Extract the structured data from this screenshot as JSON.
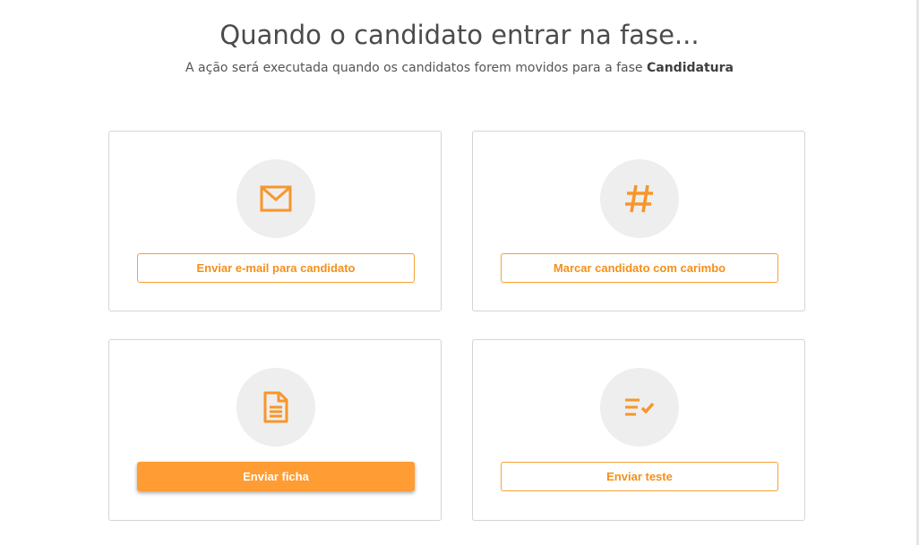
{
  "header": {
    "title": "Quando o candidato entrar na fase...",
    "subtitle_prefix": "A ação será executada quando os candidatos forem movidos para a fase ",
    "phase_name": "Candidatura"
  },
  "colors": {
    "accent": "#ff9c33",
    "accent_text": "#f58f1a",
    "icon_bg": "#eeeeee",
    "card_border": "#d4d4d4"
  },
  "actions": [
    {
      "icon": "envelope-icon",
      "label": "Enviar e-mail para candidato",
      "selected": false
    },
    {
      "icon": "hash-icon",
      "label": "Marcar candidato com carimbo",
      "selected": false
    },
    {
      "icon": "document-icon",
      "label": "Enviar ficha",
      "selected": true
    },
    {
      "icon": "checklist-icon",
      "label": "Enviar teste",
      "selected": false
    }
  ]
}
